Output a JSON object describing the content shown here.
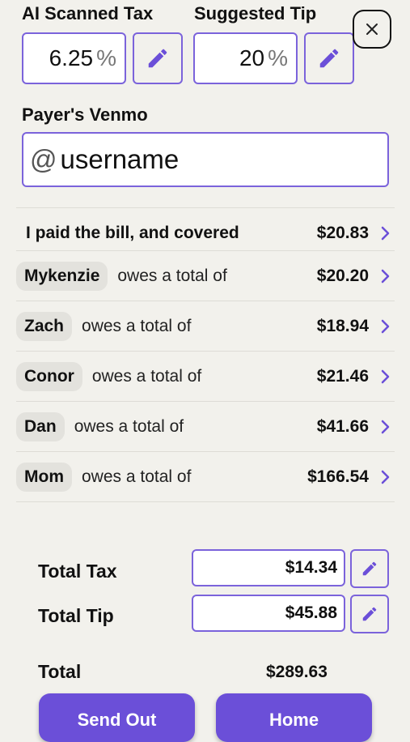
{
  "tax": {
    "label": "AI Scanned Tax",
    "value": "6.25",
    "unit": "%"
  },
  "tip": {
    "label": "Suggested Tip",
    "value": "20",
    "unit": "%"
  },
  "venmo": {
    "label": "Payer's Venmo",
    "prefix": "@",
    "placeholder": "username"
  },
  "payer_row": {
    "text": "I paid the bill, and covered",
    "amount": "$20.83"
  },
  "owes_text": "owes a total of",
  "people": [
    {
      "name": "Mykenzie",
      "amount": "$20.20"
    },
    {
      "name": "Zach",
      "amount": "$18.94"
    },
    {
      "name": "Conor",
      "amount": "$21.46"
    },
    {
      "name": "Dan",
      "amount": "$41.66"
    },
    {
      "name": "Mom",
      "amount": "$166.54"
    }
  ],
  "totals": {
    "tax_label": "Total Tax",
    "tax_value": "$14.34",
    "tip_label": "Total Tip",
    "tip_value": "$45.88",
    "total_label": "Total",
    "total_value": "$289.63"
  },
  "buttons": {
    "send": "Send Out",
    "home": "Home"
  },
  "icons": {
    "edit": "pencil-icon",
    "close": "close-icon",
    "chevron": "chevron-right-icon"
  },
  "colors": {
    "accent": "#6b4fd8",
    "background": "#f2f1ec"
  }
}
